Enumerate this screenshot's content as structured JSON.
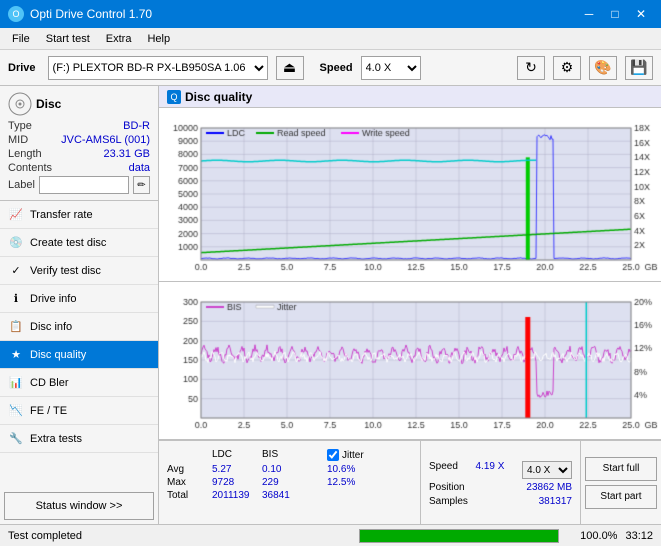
{
  "titleBar": {
    "title": "Opti Drive Control 1.70",
    "minBtn": "─",
    "maxBtn": "□",
    "closeBtn": "✕"
  },
  "menuBar": {
    "items": [
      "File",
      "Start test",
      "Extra",
      "Help"
    ]
  },
  "toolbar": {
    "driveLabel": "Drive",
    "driveValue": "(F:)  PLEXTOR BD-R  PX-LB950SA 1.06",
    "speedLabel": "Speed",
    "speedValue": "4.0 X"
  },
  "disc": {
    "header": "Disc",
    "typeLabel": "Type",
    "typeValue": "BD-R",
    "midLabel": "MID",
    "midValue": "JVC-AMS6L (001)",
    "lengthLabel": "Length",
    "lengthValue": "23.31 GB",
    "contentsLabel": "Contents",
    "contentsValue": "data",
    "labelLabel": "Label",
    "labelValue": ""
  },
  "navItems": [
    {
      "id": "transfer-rate",
      "label": "Transfer rate",
      "icon": "📈"
    },
    {
      "id": "create-test-disc",
      "label": "Create test disc",
      "icon": "💿"
    },
    {
      "id": "verify-test-disc",
      "label": "Verify test disc",
      "icon": "✓"
    },
    {
      "id": "drive-info",
      "label": "Drive info",
      "icon": "ℹ"
    },
    {
      "id": "disc-info",
      "label": "Disc info",
      "icon": "📋"
    },
    {
      "id": "disc-quality",
      "label": "Disc quality",
      "icon": "★",
      "active": true
    },
    {
      "id": "cd-bler",
      "label": "CD Bler",
      "icon": "📊"
    },
    {
      "id": "fe-te",
      "label": "FE / TE",
      "icon": "📉"
    },
    {
      "id": "extra-tests",
      "label": "Extra tests",
      "icon": "🔧"
    }
  ],
  "statusBtn": "Status window >>",
  "discQuality": {
    "title": "Disc quality",
    "legend1": {
      "ldc": "LDC",
      "readSpeed": "Read speed",
      "writeSpeed": "Write speed"
    },
    "legend2": {
      "bis": "BIS",
      "jitter": "Jitter"
    },
    "xAxisMax": "25.0",
    "chart1YMax": "10000",
    "chart2YMax": "300"
  },
  "stats": {
    "headers": [
      "",
      "LDC",
      "BIS",
      "",
      "Jitter",
      "Speed",
      ""
    ],
    "avgLabel": "Avg",
    "avgLDC": "5.27",
    "avgBIS": "0.10",
    "avgJitter": "10.6%",
    "maxLabel": "Max",
    "maxLDC": "9728",
    "maxBIS": "229",
    "maxJitter": "12.5%",
    "totalLabel": "Total",
    "totalLDC": "2011139",
    "totalBIS": "36841",
    "speedVal": "4.19 X",
    "speedFixed": "4.0 X",
    "positionLabel": "Position",
    "positionVal": "23862 MB",
    "samplesLabel": "Samples",
    "samplesVal": "381317",
    "jitterChecked": true,
    "startFullBtn": "Start full",
    "startPartBtn": "Start part"
  },
  "statusBar": {
    "text": "Test completed",
    "progress": 100,
    "progressText": "100.0%",
    "time": "33:12"
  },
  "colors": {
    "ldc": "#4040ff",
    "readSpeed": "#00aa00",
    "writeSpeed": "#ff00ff",
    "bis": "#cc44cc",
    "jitter": "#ff0000",
    "accent": "#0078d7",
    "gridLine": "#c0c0d0",
    "chartBg": "#e8e8f8"
  }
}
